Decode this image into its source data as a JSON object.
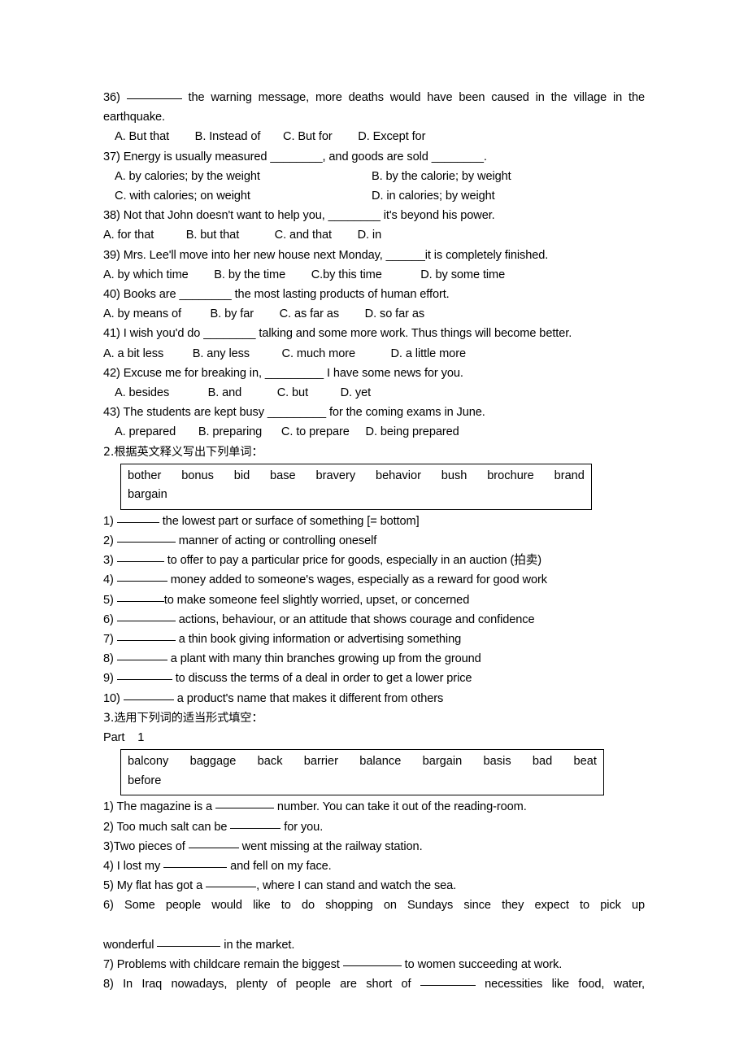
{
  "document": {
    "type": "english-grammar-vocabulary-worksheet",
    "background_color": "#ffffff",
    "text_color": "#000000"
  },
  "multiple_choice": {
    "questions": [
      {
        "number": "36)",
        "stem_before": "36) ",
        "stem_mid": " the warning message, more deaths would have been caused in the village in the earthquake.",
        "options_line": "A. But that        B. Instead of       C. But for        D. Except for",
        "options": [
          "A. But that",
          "B. Instead of",
          "C. But for",
          "D. Except for"
        ]
      },
      {
        "number": "37)",
        "stem": "37) Energy is usually measured ________, and goods are sold ________.",
        "options_col_a": "A. by calories; by the weight",
        "options_col_b": "B. by the calorie; by weight",
        "options_col_c": "C. with calories; on weight",
        "options_col_d": "D. in calories; by weight"
      },
      {
        "number": "38)",
        "stem": "38) Not that John doesn't want to help you, ________ it's beyond his power.",
        "options_line": "A. for that          B. but that           C. and that        D. in",
        "options": [
          "A. for that",
          "B. but that",
          "C. and that",
          "D. in"
        ]
      },
      {
        "number": "39)",
        "stem": "39) Mrs. Lee'll move into her new house next Monday, ______it is completely finished.",
        "options_line": "A. by which time        B. by the time        C.by this time            D. by some time",
        "options": [
          "A. by which time",
          "B. by the time",
          "C.by this time",
          "D. by some time"
        ]
      },
      {
        "number": "40)",
        "stem": "40) Books are ________ the most lasting products of human effort.",
        "options_line": "A. by means of         B. by far        C. as far as        D. so far as",
        "options": [
          "A. by means of",
          "B. by far",
          "C. as far as",
          "D. so far as"
        ]
      },
      {
        "number": "41)",
        "stem": "41) I wish you'd do ________ talking and some more work. Thus things will become better.",
        "options_line": "A. a bit less         B. any less          C. much more           D. a little more",
        "options": [
          "A. a bit less",
          "B. any less",
          "C. much more",
          "D. a little more"
        ]
      },
      {
        "number": "42)",
        "stem": "42) Excuse me for breaking in, _________ I have some news for you.",
        "options_line": "A. besides            B. and           C. but          D. yet",
        "options": [
          "A. besides",
          "B. and",
          "C. but",
          "D. yet"
        ]
      },
      {
        "number": "43)",
        "stem": "43) The students are kept busy _________ for the coming exams in June.",
        "options_line": "A. prepared       B. preparing      C. to prepare     D. being prepared",
        "options": [
          "A. prepared",
          "B. preparing",
          "C. to prepare",
          "D. being prepared"
        ]
      }
    ]
  },
  "section2": {
    "heading": "2.根据英文释义写出下列单词：",
    "wordbank_row1": [
      "bother",
      "bonus",
      "bid",
      "base",
      "bravery",
      "behavior",
      "bush",
      "brochure",
      "brand"
    ],
    "wordbank_row2": "bargain",
    "definitions": [
      {
        "number": "1)",
        "text": "the lowest part or surface of something [= bottom]",
        "blank": "b52"
      },
      {
        "number": "2)",
        "text": "manner of acting or controlling oneself",
        "blank": "b72"
      },
      {
        "number": "3)",
        "text": "to offer to pay a particular price for goods, especially in an auction (拍卖)",
        "blank": "b58"
      },
      {
        "number": "4)",
        "text": "money added to someone's wages, especially as a reward for good work",
        "blank": "b62"
      },
      {
        "number": "5)",
        "text": "to make someone feel slightly worried, upset, or concerned",
        "blank": "b58"
      },
      {
        "number": "6)",
        "text": "actions, behaviour, or an attitude that shows courage and confidence",
        "blank": "b72"
      },
      {
        "number": "7)",
        "text": "a thin book giving information or advertising something",
        "blank": "b72"
      },
      {
        "number": "8)",
        "text": "a plant with many thin branches growing up from the ground",
        "blank": "b62"
      },
      {
        "number": "9)",
        "text": "to discuss the terms of a deal in order to get a lower price",
        "blank": "b68"
      },
      {
        "number": "10)",
        "text": "a product's name that makes it different from others",
        "blank": "b62"
      }
    ]
  },
  "section3": {
    "heading": "3.选用下列词的适当形式填空：",
    "part_label": "Part",
    "part_number": "1",
    "wordbank_row1": [
      "balcony",
      "baggage",
      "back",
      "barrier",
      "balance",
      "bargain",
      "basis",
      "bad",
      "beat"
    ],
    "wordbank_row2": "before",
    "sentences": [
      {
        "number": "1)",
        "before": "1) The magazine is a ",
        "after": " number. You can take it out of the reading-room.",
        "blank": "b72"
      },
      {
        "number": "2)",
        "before": "2) Too much salt can be ",
        "after": " for you.",
        "blank": "b62"
      },
      {
        "number": "3)",
        "before": "3)Two pieces of ",
        "after": " went missing at the railway station.",
        "blank": "b62"
      },
      {
        "number": "4)",
        "before": "4) I lost my ",
        "after": " and fell on my face.",
        "blank": "b78"
      },
      {
        "number": "5)",
        "before": "5) My flat has got a ",
        "after": ", where I can stand and watch the sea.",
        "blank": "b62"
      },
      {
        "number": "6)",
        "line1": "6) Some people would like to do shopping on Sundays since they expect to pick up",
        "line2_before": "wonderful ",
        "line2_after": " in the market.",
        "blank": "b78"
      },
      {
        "number": "7)",
        "before": "7) Problems with childcare remain the biggest ",
        "after": " to women succeeding at work.",
        "blank": "b72"
      },
      {
        "number": "8)",
        "before": "8) In Iraq nowadays, plenty of people are short of ",
        "after": " necessities like food, water,",
        "blank": "b68"
      }
    ]
  }
}
